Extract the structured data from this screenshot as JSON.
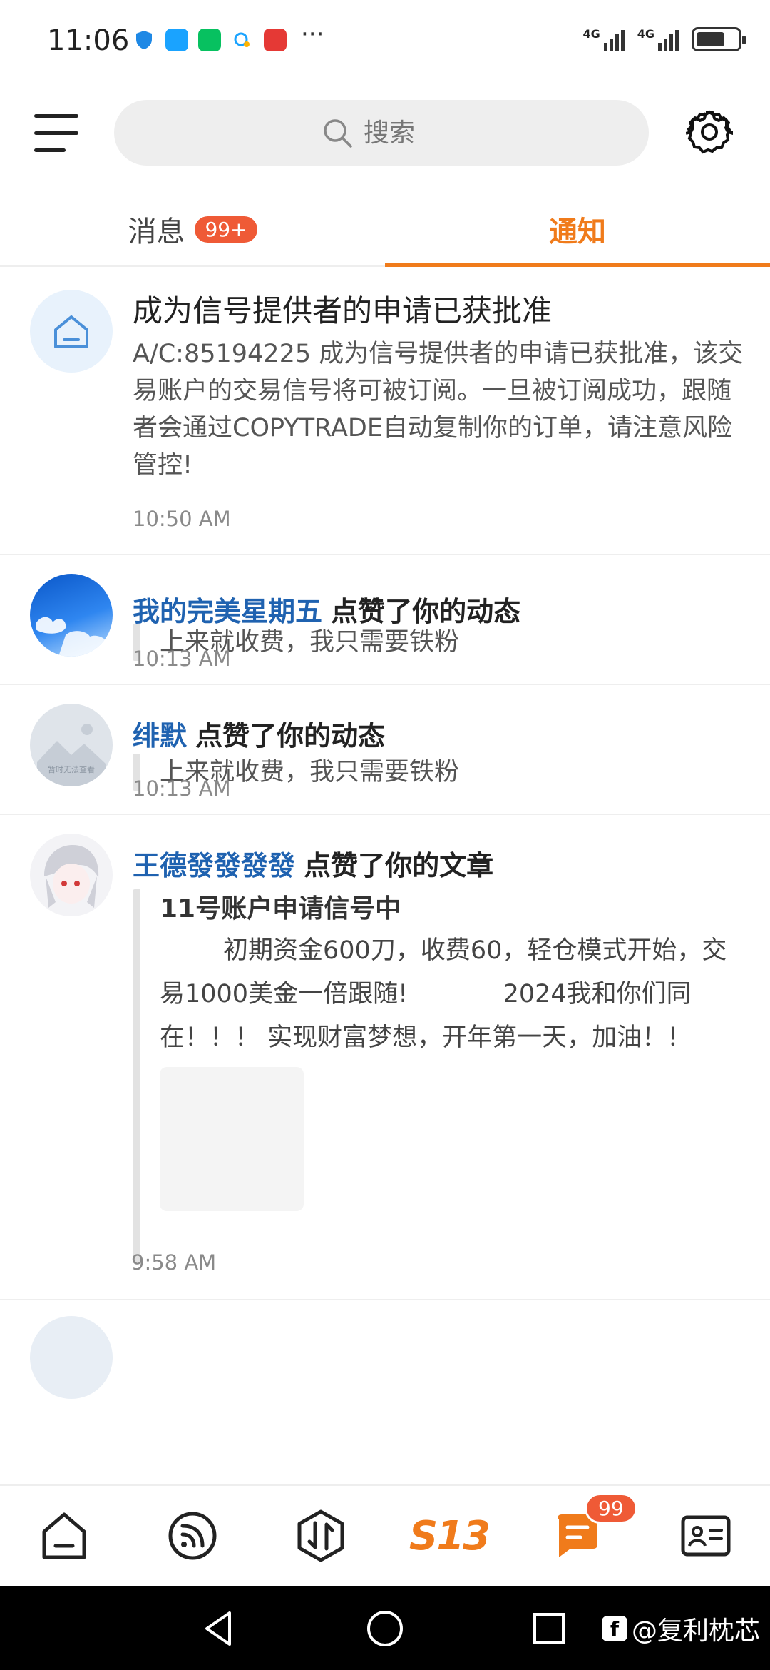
{
  "status_bar": {
    "time": "11:06",
    "dots": "···",
    "network_1": "4G",
    "network_2": "4G"
  },
  "header": {
    "search_placeholder": "搜索"
  },
  "tabs": {
    "messages_label": "消息",
    "messages_badge": "99+",
    "notify_label": "通知"
  },
  "notifications": [
    {
      "title": "成为信号提供者的申请已获批准",
      "body": "A/C:85194225 成为信号提供者的申请已获批准，该交易账户的交易信号将可被订阅。一旦被订阅成功，跟随者会通过COPYTRADE自动复制你的订单，请注意风险管控!",
      "time": "10:50 AM"
    },
    {
      "user": "我的完美星期五",
      "action": "点赞了你的动态",
      "quote": "上来就收费，我只需要铁粉",
      "time": "10:13 AM"
    },
    {
      "user": "绯默",
      "action": "点赞了你的动态",
      "quote": "上来就收费，我只需要铁粉",
      "avatar_caption": "暂时无法查看",
      "time": "10:13 AM"
    },
    {
      "user": "王德發發發發",
      "action": "点赞了你的文章",
      "quote_title": "11号账户申请信号中",
      "quote_body": "        初期资金600刀，收费60，轻仓模式开始，交易1000美金一倍跟随!            2024我和你们同在！！！ 实现财富梦想，开年第一天，加油！！",
      "time": "9:58 AM"
    }
  ],
  "bottom_nav": {
    "brand_label": "S13",
    "messages_badge": "99"
  },
  "watermark": {
    "text": "@复利枕芯"
  },
  "colors": {
    "accent": "#f07b1b",
    "badge": "#ef5a36",
    "username": "#1f62b0"
  }
}
